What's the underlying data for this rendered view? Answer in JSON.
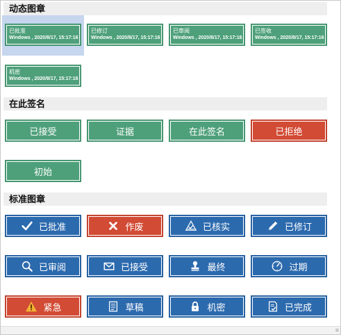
{
  "sections": {
    "dynamic": "动态图章",
    "sign_here": "在此签名",
    "standard": "标准图章"
  },
  "dynamic_stamps": [
    {
      "title": "已批准",
      "sub": "Windows , 2020/8/17, 15:17:16"
    },
    {
      "title": "已修订",
      "sub": "Windows , 2020/8/17, 15:17:16"
    },
    {
      "title": "已审阅",
      "sub": "Windows , 2020/8/17, 15:17:16"
    },
    {
      "title": "已签收",
      "sub": "Windows , 2020/8/17, 15:17:16"
    },
    {
      "title": "机密",
      "sub": "Windows , 2020/8/17, 15:17:16"
    }
  ],
  "sign_buttons": [
    {
      "label": "已接受"
    },
    {
      "label": "证据"
    },
    {
      "label": "在此签名"
    },
    {
      "label": "已拒绝"
    },
    {
      "label": "初始"
    }
  ],
  "standard_buttons": [
    {
      "label": "已批准",
      "icon": "check-icon"
    },
    {
      "label": "作废",
      "icon": "x-icon"
    },
    {
      "label": "已核实",
      "icon": "triangle-check-icon"
    },
    {
      "label": "已修订",
      "icon": "pencil-icon"
    },
    {
      "label": "已审阅",
      "icon": "magnifier-icon"
    },
    {
      "label": "已接受",
      "icon": "envelope-icon"
    },
    {
      "label": "最终",
      "icon": "stamp-icon"
    },
    {
      "label": "过期",
      "icon": "clock-icon"
    },
    {
      "label": "紧急",
      "icon": "warning-icon"
    },
    {
      "label": "草稿",
      "icon": "document-icon"
    },
    {
      "label": "机密",
      "icon": "lock-icon"
    },
    {
      "label": "已完成",
      "icon": "document-check-icon"
    }
  ],
  "colors": {
    "green": "#4ea07a",
    "red": "#d24b35",
    "blue": "#2c6aae",
    "selected": "#c6d6ee"
  }
}
